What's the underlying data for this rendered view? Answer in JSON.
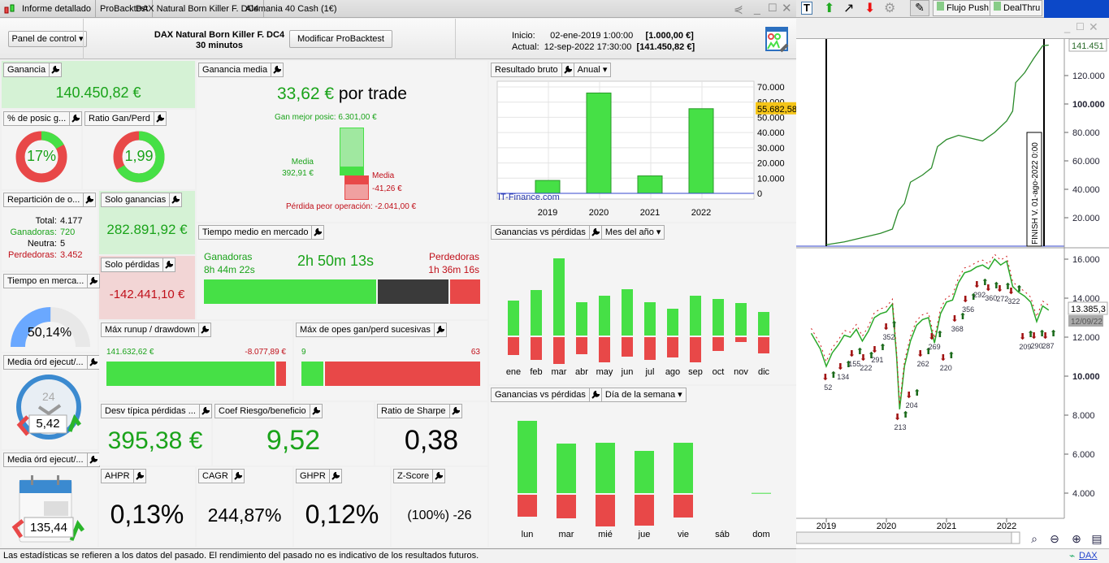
{
  "tabs": [
    "Informe detallado",
    "ProBacktest",
    "DAX Natural Born Killer F. DC4",
    "Alemania 40 Cash (1€)"
  ],
  "header": {
    "panel_control": "Panel de control",
    "strategy": "DAX Natural Born Killer F. DC4",
    "timeframe": "30 minutos",
    "modify_button": "Modificar ProBacktest",
    "inicio_label": "Inicio:",
    "inicio_date": "02-ene-2019 1:00:00",
    "inicio_value": "[1.000,00 €]",
    "actual_label": "Actual:",
    "actual_date": "12-sep-2022 17:30:00",
    "actual_value": "[141.450,82 €]"
  },
  "panels": {
    "ganancia": {
      "title": "Ganancia",
      "value": "140.450,82 €"
    },
    "pct_ganadoras": {
      "title": "% de posic g...",
      "value": "17%",
      "fraction": 0.17
    },
    "ratio": {
      "title": "Ratio Gan/Perd",
      "value": "1,99",
      "fraction": 0.665
    },
    "reparticion": {
      "title": "Repartición de o...",
      "total_label": "Total:",
      "total": "4.177",
      "gan_label": "Ganadoras:",
      "gan": "720",
      "neutra_label": "Neutra:",
      "neutra": "5",
      "perd_label": "Perdedoras:",
      "perd": "3.452"
    },
    "solo_ganancias": {
      "title": "Solo ganancias",
      "value": "282.891,92 €"
    },
    "solo_perdidas": {
      "title": "Solo pérdidas",
      "value": "-142.441,10 €"
    },
    "tiempo_mercado": {
      "title": "Tiempo en merca...",
      "value": "50,14%",
      "fraction": 0.5014
    },
    "media_ord1": {
      "title": "Media órd ejecut/...",
      "value": "5,42",
      "clock_label": "24"
    },
    "media_ord2": {
      "title": "Media órd ejecut/...",
      "value": "135,44"
    },
    "ganancia_media": {
      "title": "Ganancia media",
      "value": "33,62 €",
      "suffix": "por trade",
      "best": "Gan mejor posic: 6.301,00 €",
      "media_gan_label": "Media",
      "media_gan": "392,91 €",
      "media_perd_label": "Media",
      "media_perd": "-41,26 €",
      "worst": "Pérdida peor operación: -2.041,00 €"
    },
    "tiempo_medio": {
      "title": "Tiempo medio en mercado",
      "gan_label": "Ganadoras",
      "gan_time": "8h 44m 22s",
      "avg": "2h 50m 13s",
      "perd_label": "Perdedoras",
      "perd_time": "1h 36m 16s",
      "split": [
        0.63,
        0.26,
        0.11
      ]
    },
    "runup": {
      "title": "Máx runup / drawdown",
      "runup": "141.632,62 €",
      "drawdown": "-8.077,89 €",
      "fraction": 0.946
    },
    "sucesivas": {
      "title": "Máx de opes gan/perd sucesivas",
      "gan": "9",
      "perd": "63",
      "fraction": 0.125
    },
    "desv": {
      "title": "Desv típica pérdidas ...",
      "value": "395,38 €"
    },
    "coef": {
      "title": "Coef Riesgo/beneficio",
      "value": "9,52"
    },
    "sharpe": {
      "title": "Ratio de Sharpe",
      "value": "0,38"
    },
    "ahpr": {
      "title": "AHPR",
      "value": "0,13%"
    },
    "cagr": {
      "title": "CAGR",
      "value": "244,87%"
    },
    "ghpr": {
      "title": "GHPR",
      "value": "0,12%"
    },
    "zscore": {
      "title": "Z-Score",
      "value": "(100%) -26"
    }
  },
  "status": "Las estadísticas se refieren a los datos del pasado. El rendimiento del pasado no es indicativo de los resultados futuros.",
  "right": {
    "toolbar": {
      "flujo": "Flujo Push",
      "dealthru": "DealThru"
    },
    "finish_label": "FINISH V. 01-ago-2022 0:00",
    "equity_last": "141.451",
    "price_last": "13.385,3",
    "price_date": "12/09/22",
    "instrument": "DAX"
  },
  "chart_data": [
    {
      "type": "bar",
      "title": "Resultado bruto",
      "dropdown": "Anual",
      "categories": [
        "2019",
        "2020",
        "2021",
        "2022"
      ],
      "values": [
        8500,
        66000,
        11500,
        55682.58
      ],
      "highlight": "55.682,58",
      "ylim": [
        0,
        70000
      ],
      "yticks": [
        "70.000",
        "60.000",
        "50.000",
        "40.000",
        "30.000",
        "20.000",
        "10.000",
        "0"
      ],
      "watermark": "IT-Finance.com"
    },
    {
      "type": "bar",
      "title": "Ganancias vs pérdidas",
      "dropdown": "Mes del año",
      "categories": [
        "ene",
        "feb",
        "mar",
        "abr",
        "may",
        "jun",
        "jul",
        "ago",
        "sep",
        "oct",
        "nov",
        "dic"
      ],
      "series": [
        {
          "name": "ganancias",
          "values": [
            43,
            56,
            95,
            41,
            49,
            57,
            41,
            33,
            49,
            45,
            40,
            29
          ]
        },
        {
          "name": "pérdidas",
          "values": [
            22,
            28,
            33,
            21,
            31,
            24,
            28,
            25,
            31,
            17,
            6,
            20
          ]
        }
      ]
    },
    {
      "type": "bar",
      "title": "Ganancias vs pérdidas",
      "dropdown": "Día de la semana",
      "categories": [
        "lun",
        "mar",
        "mié",
        "jue",
        "vie",
        "sáb",
        "dom"
      ],
      "series": [
        {
          "name": "ganancias",
          "values": [
            89,
            61,
            62,
            52,
            62,
            0,
            0.3
          ]
        },
        {
          "name": "pérdidas",
          "values": [
            27,
            29,
            39,
            38,
            28,
            0,
            0
          ]
        }
      ]
    },
    {
      "type": "line",
      "title": "Equity",
      "yticks": [
        "120.000",
        "100.000",
        "80.000",
        "60.000",
        "40.000",
        "20.000"
      ],
      "x": [
        2019.0,
        2019.3,
        2019.6,
        2019.9,
        2020.1,
        2020.2,
        2020.3,
        2020.4,
        2020.6,
        2020.75,
        2020.85,
        2021.0,
        2021.2,
        2021.4,
        2021.6,
        2021.8,
        2022.0,
        2022.1,
        2022.15,
        2022.3,
        2022.45,
        2022.6,
        2022.7
      ],
      "y": [
        1000,
        3000,
        6000,
        9000,
        12000,
        25000,
        30000,
        45000,
        50000,
        55000,
        70000,
        75000,
        78000,
        76000,
        74000,
        80000,
        88000,
        95000,
        115000,
        122000,
        132000,
        141000,
        141451
      ]
    },
    {
      "type": "line",
      "title": "DAX",
      "xticks": [
        "2019",
        "2020",
        "2021",
        "2022"
      ],
      "yticks": [
        "16.000",
        "14.000",
        "12.000",
        "10.000",
        "8.000",
        "6.000",
        "4.000"
      ],
      "x": [
        2018.75,
        2018.9,
        2019.0,
        2019.1,
        2019.2,
        2019.3,
        2019.4,
        2019.5,
        2019.6,
        2019.7,
        2019.8,
        2019.9,
        2020.0,
        2020.1,
        2020.17,
        2020.22,
        2020.3,
        2020.4,
        2020.5,
        2020.6,
        2020.7,
        2020.8,
        2020.9,
        2021.0,
        2021.1,
        2021.2,
        2021.3,
        2021.4,
        2021.5,
        2021.6,
        2021.7,
        2021.8,
        2021.9,
        2022.0,
        2022.1,
        2022.2,
        2022.3,
        2022.4,
        2022.5,
        2022.6,
        2022.7
      ],
      "y": [
        12200,
        11400,
        10500,
        11200,
        11600,
        12100,
        12000,
        12400,
        11800,
        12300,
        13000,
        13200,
        13300,
        13700,
        11000,
        8300,
        10500,
        11800,
        12600,
        12900,
        13000,
        11700,
        13200,
        13800,
        13900,
        14800,
        15300,
        15400,
        15600,
        15700,
        15500,
        16000,
        15700,
        15900,
        14600,
        14300,
        14100,
        13800,
        12800,
        13600,
        13385
      ]
    },
    {
      "type": "annotations",
      "title": "Operaciones",
      "items": [
        {
          "label": "52",
          "x": 2019.03,
          "y": 9460
        },
        {
          "label": "134",
          "x": 2019.28,
          "y": 10000
        },
        {
          "label": "155",
          "x": 2019.47,
          "y": 10670
        },
        {
          "label": "222",
          "x": 2019.66,
          "y": 10460
        },
        {
          "label": "291",
          "x": 2019.85,
          "y": 10880
        },
        {
          "label": "352",
          "x": 2020.04,
          "y": 12040
        },
        {
          "label": "213",
          "x": 2020.23,
          "y": 7420
        },
        {
          "label": "204",
          "x": 2020.42,
          "y": 8540
        },
        {
          "label": "262",
          "x": 2020.61,
          "y": 10670
        },
        {
          "label": "269",
          "x": 2020.8,
          "y": 11540
        },
        {
          "label": "220",
          "x": 2020.99,
          "y": 10460
        },
        {
          "label": "368",
          "x": 2021.18,
          "y": 12460
        },
        {
          "label": "356",
          "x": 2021.36,
          "y": 13460
        },
        {
          "label": "292",
          "x": 2021.55,
          "y": 14210
        },
        {
          "label": "360",
          "x": 2021.74,
          "y": 14040
        },
        {
          "label": "272",
          "x": 2021.93,
          "y": 14000
        },
        {
          "label": "322",
          "x": 2022.12,
          "y": 13880
        },
        {
          "label": "209",
          "x": 2022.31,
          "y": 11540
        },
        {
          "label": "290",
          "x": 2022.5,
          "y": 11580
        },
        {
          "label": "287",
          "x": 2022.69,
          "y": 11580
        }
      ]
    }
  ],
  "colors": {
    "green": "#46e046",
    "red": "#e84848",
    "text_green": "#1aa31a",
    "text_red": "#c0101a",
    "panel_green": "#d5f2d5",
    "panel_red": "#f2d5d5",
    "blue_gauge": "#6aa8ff"
  }
}
